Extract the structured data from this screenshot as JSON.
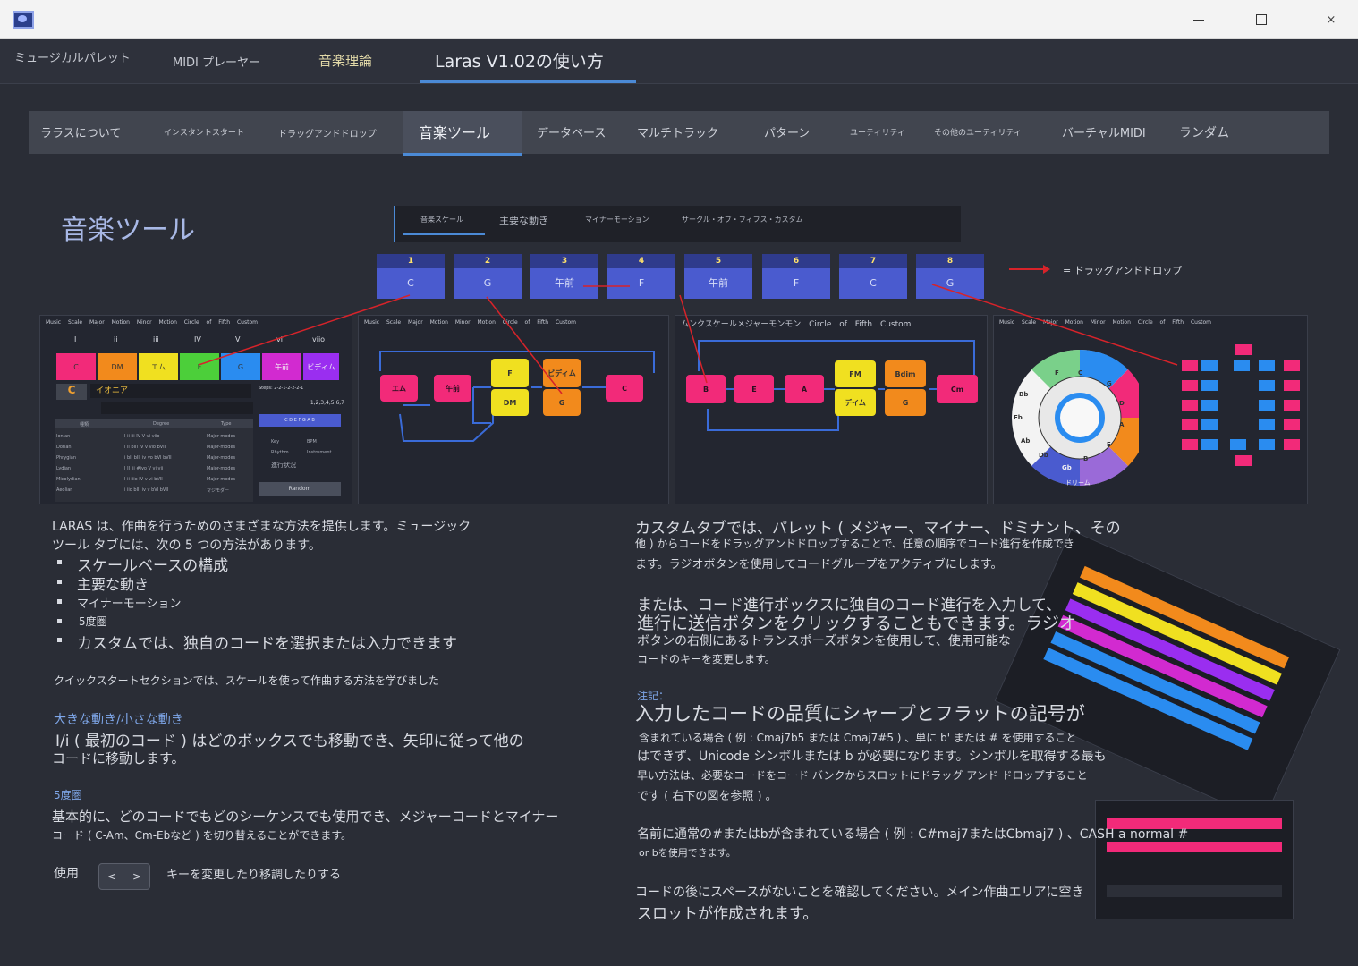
{
  "window": {
    "close_glyph": "×"
  },
  "main_tabs": [
    "ミュージカルパレット",
    "MIDI プレーヤー",
    "音楽理論",
    "Laras V1.02の使い方"
  ],
  "sub_tabs": [
    "ララスについて",
    "インスタントスタート",
    "ドラッグアンドドロップ",
    "音楽ツール",
    "データベース",
    "マルチトラック",
    "パターン",
    "ユーティリティ",
    "その他のユーティリティ",
    "バーチャルMIDI",
    "ランダム"
  ],
  "page_title": "音楽ツール",
  "mini_tabs": [
    "音楽スケール",
    "主要な動き",
    "マイナーモーション",
    "サークル・オブ・フィフス・カスタム"
  ],
  "chord_row": [
    {
      "num": "1",
      "name": "C"
    },
    {
      "num": "2",
      "name": "G"
    },
    {
      "num": "3",
      "name": "午前"
    },
    {
      "num": "4",
      "name": "F"
    },
    {
      "num": "5",
      "name": "午前"
    },
    {
      "num": "6",
      "name": "F"
    },
    {
      "num": "7",
      "name": "C"
    },
    {
      "num": "8",
      "name": "G"
    }
  ],
  "legend": "= ドラッグアンドドロップ",
  "panel1": {
    "tabs": "Music Scale  Major Motion  Minor Motion  Circle of Fifth  Custom",
    "degrees": [
      "I",
      "ii",
      "iii",
      "IV",
      "V",
      "vi",
      "viio"
    ],
    "chords": [
      "C",
      "DM",
      "エム",
      "F",
      "G",
      "午前",
      "ビディム"
    ],
    "key": "C",
    "mode": "イオニア",
    "steps_label": "Steps: 2-2-1-2-2-2-1",
    "steps2": "1,2,3,4,5,6,7",
    "notes": "C D E F G A B",
    "table_headers": [
      "種類",
      "Degree",
      "Type"
    ],
    "rows": [
      [
        "Ionian",
        "I ii iii IV V vi viio",
        "Major-modes"
      ],
      [
        "Dorian",
        "i ii bIII IV v vio bVII",
        "Major-modes"
      ],
      [
        "Phrygian",
        "i bII bIII iv vo bVI bVII",
        "Major-modes"
      ],
      [
        "Lydian",
        "I II iii #ivo V vi vii",
        "Major-modes"
      ],
      [
        "Mixolydian",
        "I ii iiio IV v vi bVII",
        "Major-modes"
      ],
      [
        "Aeolian",
        "i iio bIII iv v bVI bVII",
        "マジモダー"
      ]
    ],
    "checks": [
      "Key",
      "BPM",
      "Rhythm",
      "Instrument",
      "進行状況"
    ],
    "random": "Random"
  },
  "panel2": {
    "tabs": "Music Scale  Major Motion  Minor Motion  Circle of Fifth  Custom",
    "nodes": [
      "エム",
      "午前",
      "F",
      "DM",
      "ビディム",
      "G",
      "C"
    ]
  },
  "panel3": {
    "tabs": "ムンクスケールメジャーモンモン  Circle of Fifth  Custom",
    "nodes": [
      "B",
      "E",
      "A",
      "FM",
      "デイム",
      "Bdim",
      "G",
      "Cm"
    ]
  },
  "panel4": {
    "tabs": "Music Scale  Major Motion  Minor Motion  Circle of Fifth  Custom",
    "wheel_label": "ドリーム",
    "keys": [
      "C",
      "G",
      "D",
      "A",
      "E",
      "B",
      "Gb",
      "Db",
      "Ab",
      "Eb",
      "Bb",
      "F"
    ]
  },
  "left_text": {
    "p1_line1": "LARAS は、作曲を行うためのさまざまな方法を提供します。ミュージック",
    "p1_line2": "ツール タブには、次の 5 つの方法があります。",
    "bullets": [
      "スケールベースの構成",
      "主要な動き",
      "マイナーモーション",
      "5度圏",
      "カスタムでは、独自のコードを選択または入力できます"
    ],
    "quick": "クイックスタートセクションでは、スケールを使って作曲する方法を学びました",
    "h_motion": "大きな動き/小さな動き",
    "motion1": "I/i ( 最初のコード ) はどのボックスでも移動でき、矢印に従って他の",
    "motion2": "コードに移動します。",
    "h_circle": "5度圏",
    "circle1": "基本的に、どのコードでもどのシーケンスでも使用でき、メジャーコードとマイナー",
    "circle2": "コード ( C-Am、Cm-Ebなど ) を切り替えることができます。",
    "use_label": "使用",
    "prev": "<",
    "next": ">",
    "use_desc": "キーを変更したり移調したりする"
  },
  "right_text": {
    "c1": "カスタムタブでは、パレット ( メジャー、マイナー、ドミナント、その",
    "c2": "他 ) からコードをドラッグアンドドロップすることで、任意の順序でコード進行を作成でき",
    "c3": "ます。ラジオボタンを使用してコードグループをアクティブにします。",
    "o1": "または、コード進行ボックスに独自のコード進行を入力して、",
    "o2": "進行に送信ボタンをクリックすることもできます。ラジオ",
    "o3": "ボタンの右側にあるトランスポーズボタンを使用して、使用可能な",
    "o4": "コードのキーを変更します。",
    "note_h": "注記：",
    "n1": "入力したコードの品質にシャープとフラットの記号が",
    "n2": "含まれている場合 ( 例 : Cmaj7b5 または Cmaj7#5 ) 、単に b' または # を使用すること",
    "n3": "はできず、Unicode シンボルまたは b が必要になります。シンボルを取得する最も",
    "n4": "早い方法は、必要なコードをコード バンクからスロットにドラッグ アンド ドロップすること",
    "n5": "です ( 右下の図を参照 ) 。",
    "m1": "名前に通常の#またはbが含まれている場合 ( 例 : C#maj7またはCbmaj7 ) 、CASH a normal #",
    "m2": "or bを使用できます。",
    "s1": "コードの後にスペースがないことを確認してください。メイン作曲エリアに空き",
    "s2": "スロットが作成されます。"
  }
}
